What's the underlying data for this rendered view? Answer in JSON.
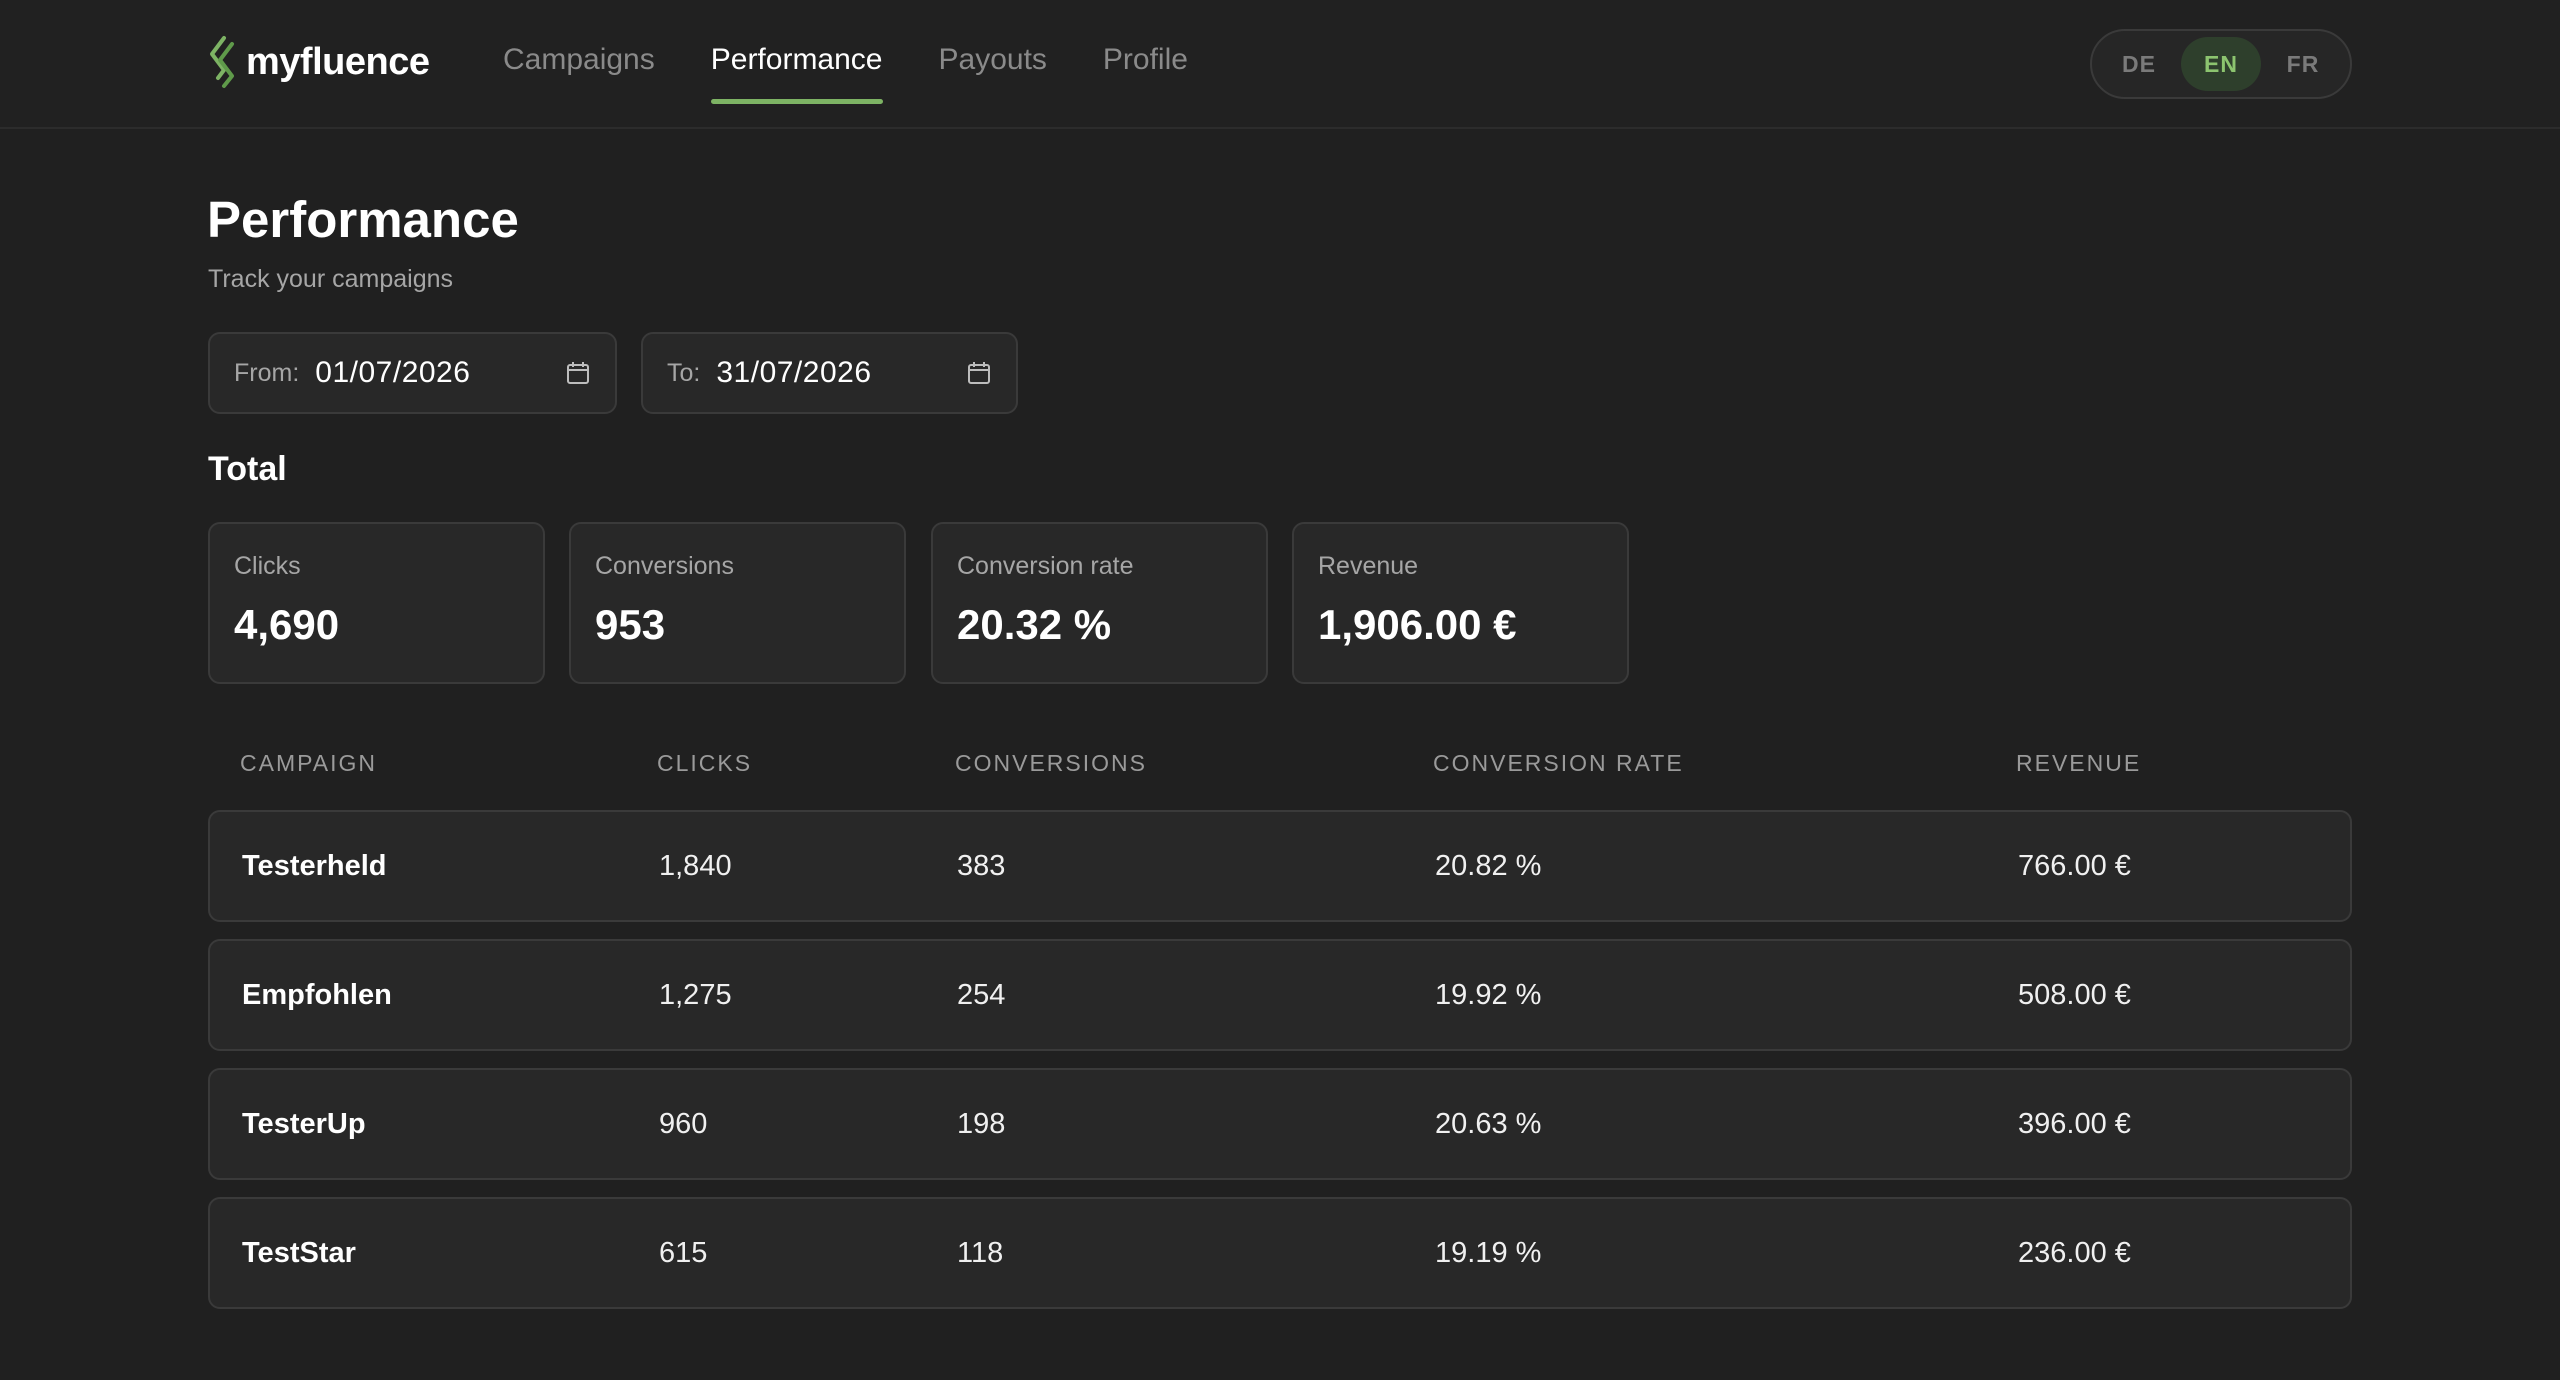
{
  "brand": {
    "name": "myfluence",
    "accent": "#7db364"
  },
  "nav": {
    "items": [
      {
        "label": "Campaigns"
      },
      {
        "label": "Performance"
      },
      {
        "label": "Payouts"
      },
      {
        "label": "Profile"
      }
    ],
    "active": "Performance"
  },
  "languages": {
    "options": [
      "DE",
      "EN",
      "FR"
    ],
    "selected": "EN"
  },
  "page": {
    "title": "Performance",
    "subtitle": "Track your campaigns"
  },
  "filters": {
    "from_label": "From:",
    "from_value": "01/07/2026",
    "to_label": "To:",
    "to_value": "31/07/2026"
  },
  "totals": {
    "title": "Total",
    "cards": [
      {
        "label": "Clicks",
        "value": "4,690"
      },
      {
        "label": "Conversions",
        "value": "953"
      },
      {
        "label": "Conversion rate",
        "value": "20.32 %"
      },
      {
        "label": "Revenue",
        "value": "1,906.00 €"
      }
    ]
  },
  "table": {
    "columns": [
      "CAMPAIGN",
      "CLICKS",
      "CONVERSIONS",
      "CONVERSION RATE",
      "REVENUE"
    ],
    "rows": [
      {
        "campaign": "Testerheld",
        "clicks": "1,840",
        "conversions": "383",
        "rate": "20.82 %",
        "revenue": "766.00 €"
      },
      {
        "campaign": "Empfohlen",
        "clicks": "1,275",
        "conversions": "254",
        "rate": "19.92 %",
        "revenue": "508.00 €"
      },
      {
        "campaign": "TesterUp",
        "clicks": "960",
        "conversions": "198",
        "rate": "20.63 %",
        "revenue": "396.00 €"
      },
      {
        "campaign": "TestStar",
        "clicks": "615",
        "conversions": "118",
        "rate": "19.19 %",
        "revenue": "236.00 €"
      }
    ]
  },
  "icons": {
    "logo": "leaf-logo-icon",
    "date": "calendar-icon"
  }
}
